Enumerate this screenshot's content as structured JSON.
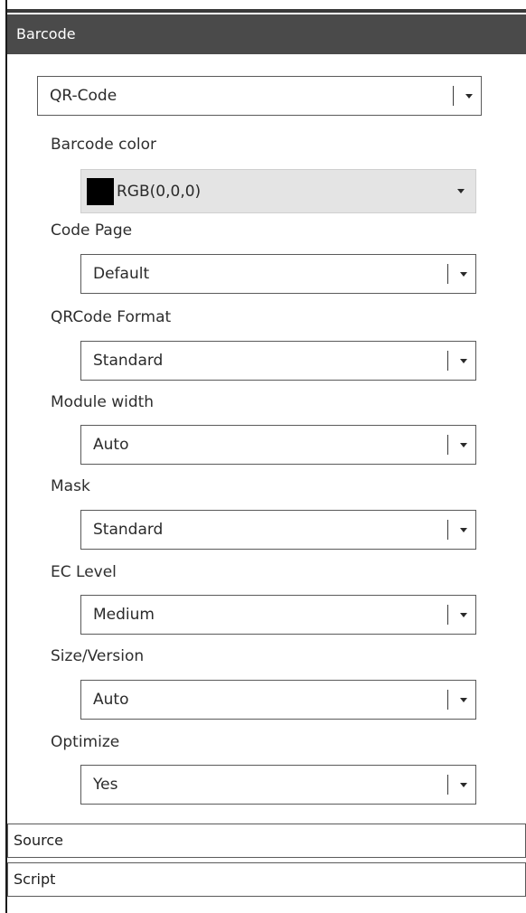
{
  "panel": {
    "title": "Barcode"
  },
  "barcode_type": {
    "value": "QR-Code"
  },
  "barcode_color": {
    "label": "Barcode color",
    "value": "RGB(0,0,0)",
    "swatch": "#000000"
  },
  "fields": [
    {
      "label": "Code Page",
      "value": "Default"
    },
    {
      "label": "QRCode Format",
      "value": "Standard"
    },
    {
      "label": "Module width",
      "value": "Auto"
    },
    {
      "label": "Mask",
      "value": "Standard"
    },
    {
      "label": "EC Level",
      "value": "Medium"
    },
    {
      "label": "Size/Version",
      "value": "Auto"
    },
    {
      "label": "Optimize",
      "value": "Yes"
    }
  ],
  "sections": [
    {
      "label": "Source"
    },
    {
      "label": "Script"
    }
  ]
}
